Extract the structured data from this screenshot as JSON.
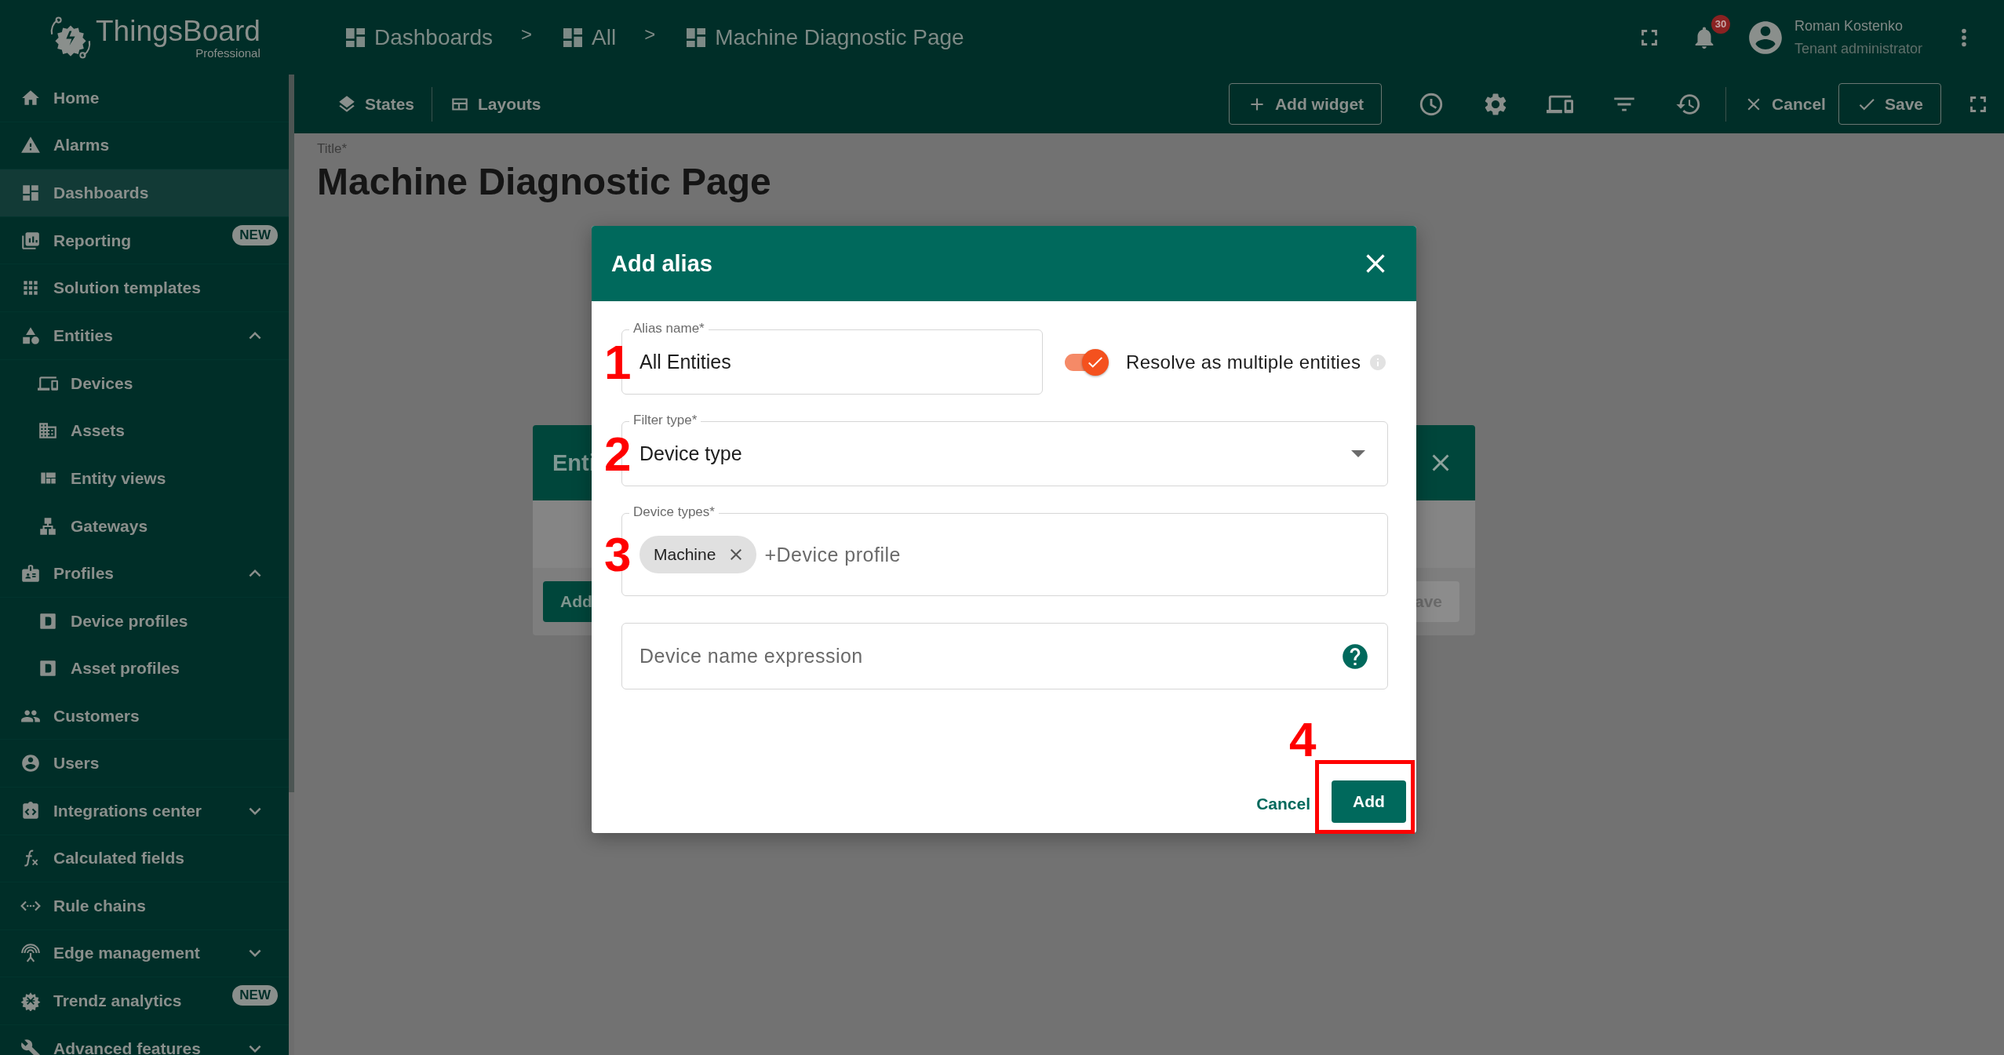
{
  "logo": {
    "name": "ThingsBoard",
    "edition": "Professional"
  },
  "sidebar": {
    "items": [
      {
        "label": "Home",
        "selected": false
      },
      {
        "label": "Alarms",
        "selected": false
      },
      {
        "label": "Dashboards",
        "selected": true
      },
      {
        "label": "Reporting",
        "selected": false,
        "badge": "NEW"
      },
      {
        "label": "Solution templates",
        "selected": false
      },
      {
        "label": "Entities",
        "selected": false,
        "expanded": true,
        "children": [
          {
            "label": "Devices",
            "selected": false
          },
          {
            "label": "Assets",
            "selected": false
          },
          {
            "label": "Entity views",
            "selected": false
          },
          {
            "label": "Gateways",
            "selected": false
          }
        ]
      },
      {
        "label": "Profiles",
        "selected": false,
        "expanded": true,
        "children": [
          {
            "label": "Device profiles",
            "selected": false
          },
          {
            "label": "Asset profiles",
            "selected": false
          }
        ]
      },
      {
        "label": "Customers",
        "selected": false
      },
      {
        "label": "Users",
        "selected": false
      },
      {
        "label": "Integrations center",
        "selected": false,
        "expanded": false
      },
      {
        "label": "Calculated fields",
        "selected": false
      },
      {
        "label": "Rule chains",
        "selected": false
      },
      {
        "label": "Edge management",
        "selected": false,
        "expanded": false
      },
      {
        "label": "Trendz analytics",
        "selected": false,
        "badge": "NEW"
      },
      {
        "label": "Advanced features",
        "selected": false,
        "expanded": false
      }
    ]
  },
  "breadcrumbs": [
    {
      "label": "Dashboards"
    },
    {
      "separator": ">",
      "label": "All"
    },
    {
      "separator": ">",
      "label": "Machine Diagnostic Page"
    }
  ],
  "notifications": {
    "count": "30"
  },
  "user": {
    "name": "Roman Kostenko",
    "role": "Tenant administrator"
  },
  "toolbar": {
    "left": [
      "States",
      "Layouts"
    ],
    "add_widget": "Add widget",
    "cancel": "Cancel",
    "save": "Save"
  },
  "dashboard": {
    "title_label": "Title*",
    "title": "Machine Diagnostic Page"
  },
  "background_dialog": {
    "title": "Enti",
    "left_button": "Add",
    "right_button": "ave"
  },
  "dialog": {
    "title": "Add alias",
    "fields": [
      {
        "kind": "text",
        "label": "Alias name*",
        "value": "All Entities",
        "step": "1"
      },
      {
        "kind": "select",
        "label": "Filter type*",
        "value": "Device type",
        "step": "2"
      },
      {
        "kind": "chips",
        "label": "Device types*",
        "chips": [
          "Machine"
        ],
        "placeholder": "+Device profile",
        "step": "3"
      },
      {
        "kind": "help",
        "placeholder": "Device name expression"
      }
    ],
    "resolve_multiple": {
      "label": "Resolve as multiple entities",
      "on": true
    },
    "cancel": "Cancel",
    "add": "Add",
    "add_step": "4",
    "add_highlighted": true
  }
}
